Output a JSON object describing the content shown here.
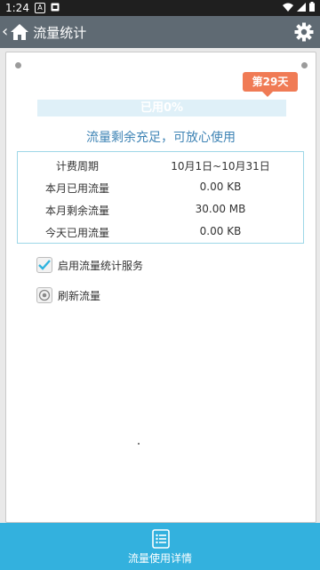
{
  "status_bar": {
    "time": "1:24",
    "badge_a": "A",
    "icons": [
      "notification-a-icon",
      "notification-b-icon",
      "wifi-icon",
      "signal-icon",
      "battery-icon"
    ]
  },
  "header": {
    "back_glyph": "‹",
    "title": "流量统计",
    "bg_color": "#5f6a73",
    "icons": [
      "home-icon",
      "settings-gear-icon"
    ]
  },
  "usage": {
    "day_badge": "第29天",
    "used_label": "已用0%",
    "used_fraction": 0,
    "status_message": "流量剩余充足，可放心使用",
    "accent": "#7cc6e7",
    "badge_color": "#f07b55",
    "rows": [
      {
        "key": "计费周期",
        "value": "10月1日~10月31日"
      },
      {
        "key": "本月已用流量",
        "value": "0.00 KB"
      },
      {
        "key": "本月剩余流量",
        "value": "30.00 MB"
      },
      {
        "key": "今天已用流量",
        "value": "0.00 KB"
      }
    ]
  },
  "options": {
    "enable_service": {
      "label": "启用流量统计服务",
      "checked": true
    },
    "refresh": {
      "label": "刷新流量"
    }
  },
  "bottom_bar": {
    "label": "流量使用详情",
    "color": "#33b1de"
  }
}
